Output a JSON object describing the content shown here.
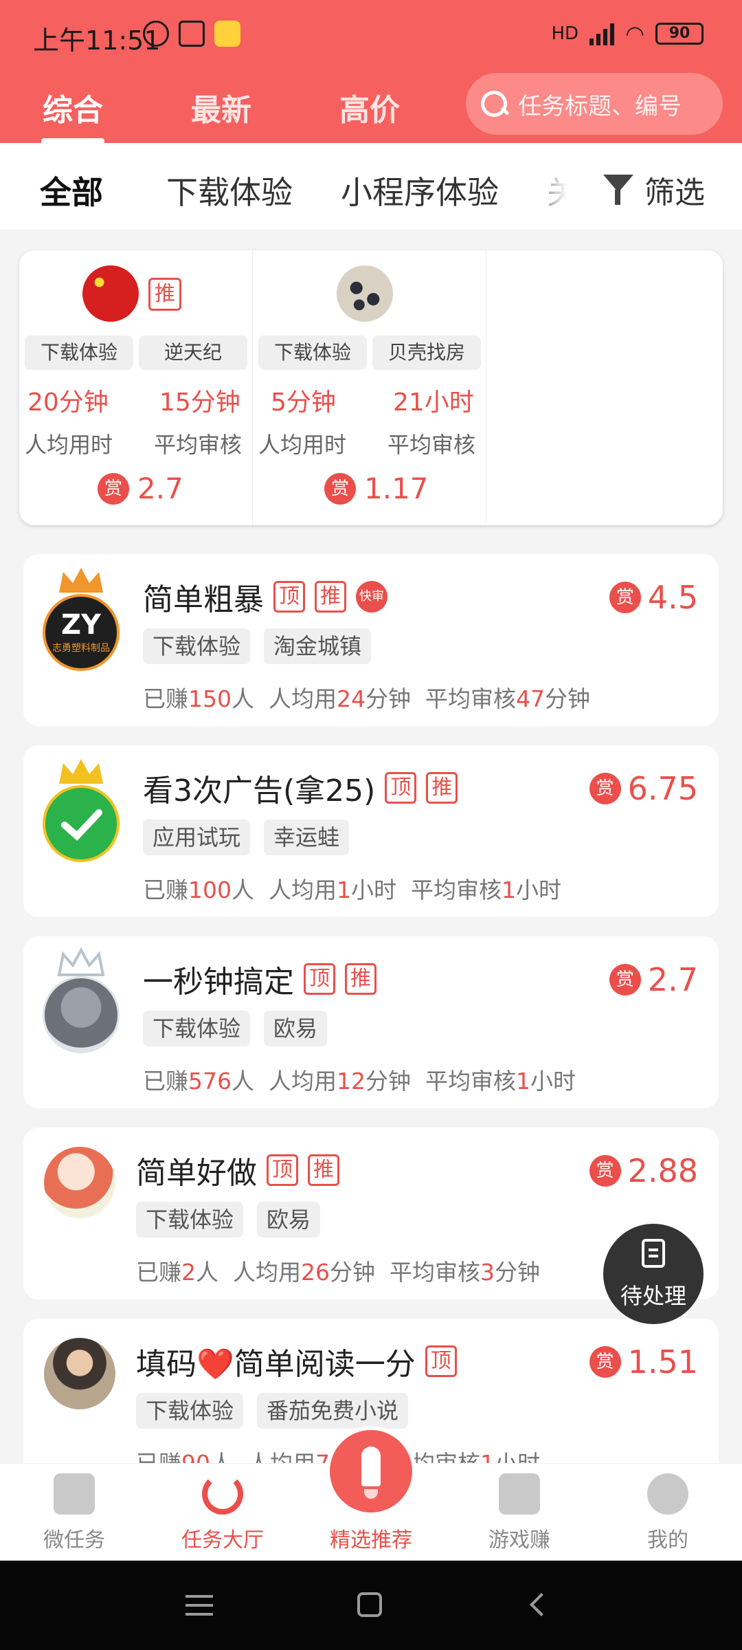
{
  "status_bar": {
    "time": "上午11:51",
    "battery": "90"
  },
  "top_tabs": [
    "综合",
    "最新",
    "高价"
  ],
  "search": {
    "placeholder": "任务标题、编号"
  },
  "categories": [
    "全部",
    "下载体验",
    "小程序体验",
    "关"
  ],
  "filter_label": "筛选",
  "featured": [
    {
      "tag": "推",
      "chip1": "下载体验",
      "chip2": "逆天纪",
      "time_avg": "20分钟",
      "review_avg": "15分钟",
      "time_label": "人均用时",
      "review_label": "平均审核",
      "reward_icon": "赏",
      "reward": "2.7"
    },
    {
      "chip1": "下载体验",
      "chip2": "贝壳找房",
      "time_avg": "5分钟",
      "review_avg": "21小时",
      "time_label": "人均用时",
      "review_label": "平均审核",
      "reward_icon": "赏",
      "reward": "1.17"
    }
  ],
  "tasks": [
    {
      "title": "简单粗暴",
      "badges": [
        "顶",
        "推"
      ],
      "fast": "快审",
      "chips": [
        "下载体验",
        "淘金城镇"
      ],
      "earned_prefix": "已赚",
      "earned": "150",
      "earned_suffix": "人",
      "avg_prefix": "人均用",
      "avg_num": "24",
      "avg_unit": "分钟",
      "review_prefix": "平均审核",
      "review_num": "47",
      "review_unit": "分钟",
      "reward_icon": "赏",
      "reward": "4.5",
      "logo_text": "ZY",
      "logo_sub": "志勇塑料制品",
      "avatar_color": "#1f1f1f"
    },
    {
      "title": "看3次广告(拿25)",
      "badges": [
        "顶",
        "推"
      ],
      "chips": [
        "应用试玩",
        "幸运蛙"
      ],
      "earned_prefix": "已赚",
      "earned": "100",
      "earned_suffix": "人",
      "avg_prefix": "人均用",
      "avg_num": "1",
      "avg_unit": "小时",
      "review_prefix": "平均审核",
      "review_num": "1",
      "review_unit": "小时",
      "reward_icon": "赏",
      "reward": "6.75",
      "avatar_color": "#2bb24a"
    },
    {
      "title": "一秒钟搞定",
      "badges": [
        "顶",
        "推"
      ],
      "chips": [
        "下载体验",
        "欧易"
      ],
      "earned_prefix": "已赚",
      "earned": "576",
      "earned_suffix": "人",
      "avg_prefix": "人均用",
      "avg_num": "12",
      "avg_unit": "分钟",
      "review_prefix": "平均审核",
      "review_num": "1",
      "review_unit": "小时",
      "reward_icon": "赏",
      "reward": "2.7",
      "avatar_color": "#7d8290"
    },
    {
      "title": "简单好做",
      "badges": [
        "顶",
        "推"
      ],
      "chips": [
        "下载体验",
        "欧易"
      ],
      "earned_prefix": "已赚",
      "earned": "2",
      "earned_suffix": "人",
      "avg_prefix": "人均用",
      "avg_num": "26",
      "avg_unit": "分钟",
      "review_prefix": "平均审核",
      "review_num": "3",
      "review_unit": "分钟",
      "reward_icon": "赏",
      "reward": "2.88",
      "avatar_color": "#f0b7a4"
    },
    {
      "title": "填码❤️简单阅读一分",
      "badges": [
        "顶"
      ],
      "chips": [
        "下载体验",
        "番茄免费小说"
      ],
      "earned_prefix": "已赚",
      "earned": "90",
      "earned_suffix": "人",
      "avg_prefix": "人均用",
      "avg_num": "7",
      "avg_unit": "分钟",
      "review_prefix": "平均审核",
      "review_num": "1",
      "review_unit": "小时",
      "reward_icon": "赏",
      "reward": "1.51",
      "avatar_color": "#8a7a6a"
    }
  ],
  "pending_label": "待处理",
  "bottom_nav": [
    "微任务",
    "任务大厅",
    "精选推荐",
    "游戏赚",
    "我的"
  ],
  "colors": {
    "brand": "#f6605e",
    "accent_red": "#e8504b"
  }
}
